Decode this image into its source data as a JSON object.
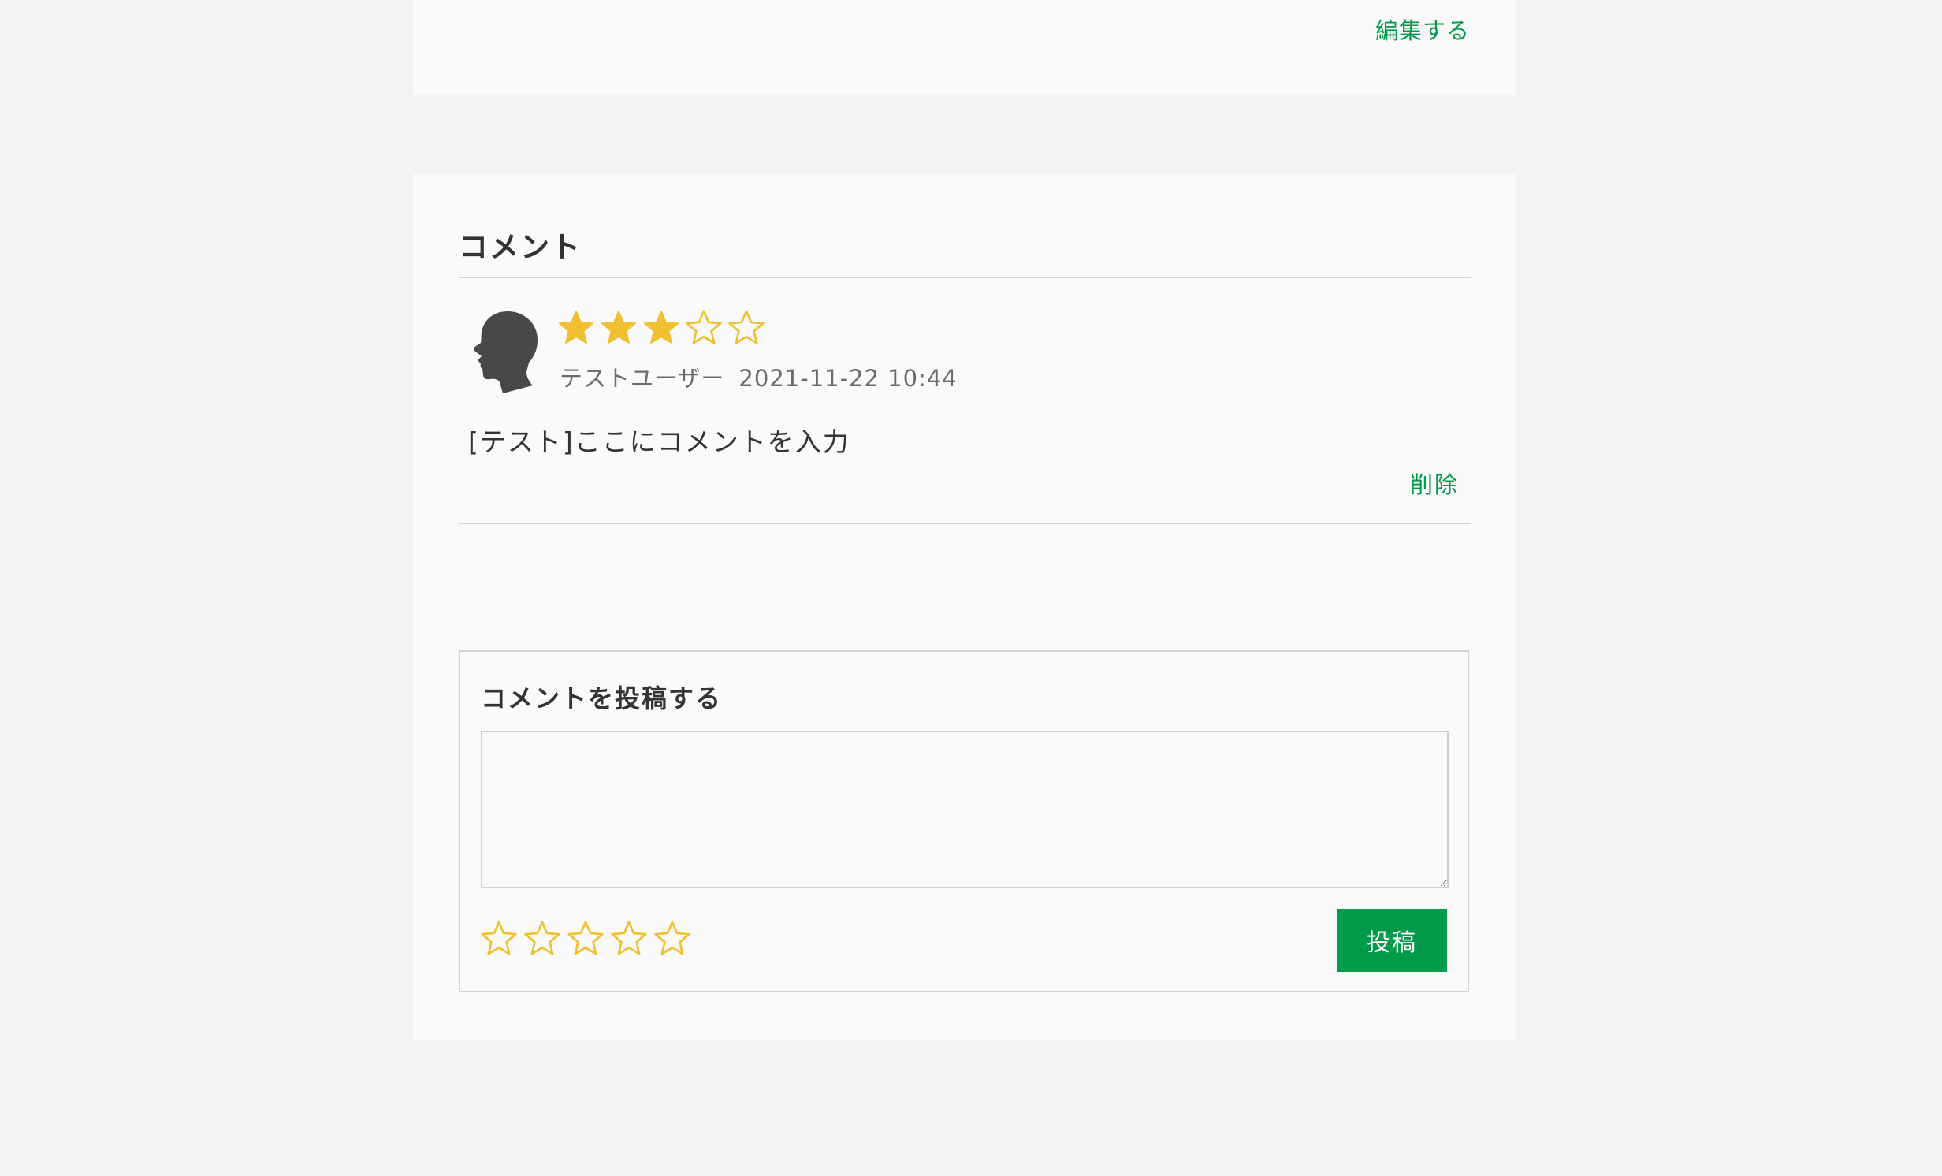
{
  "top_card": {
    "edit_label": "編集する"
  },
  "comments": {
    "title": "コメント",
    "items": [
      {
        "rating": 3,
        "max_rating": 5,
        "author": "テストユーザー",
        "date": "2021-11-22 10:44",
        "body": "[テスト]ここにコメントを入力",
        "delete_label": "削除"
      }
    ]
  },
  "post_form": {
    "title": "コメントを投稿する",
    "textarea_value": "",
    "rating": 0,
    "max_rating": 5,
    "submit_label": "投稿"
  },
  "colors": {
    "accent": "#009a4a",
    "star": "#f0c030",
    "background": "#f3f3f3",
    "card": "#fafafa"
  },
  "icons": {
    "avatar": "person-head-silhouette-icon",
    "star_filled": "star-filled-icon",
    "star_empty": "star-outline-icon"
  }
}
